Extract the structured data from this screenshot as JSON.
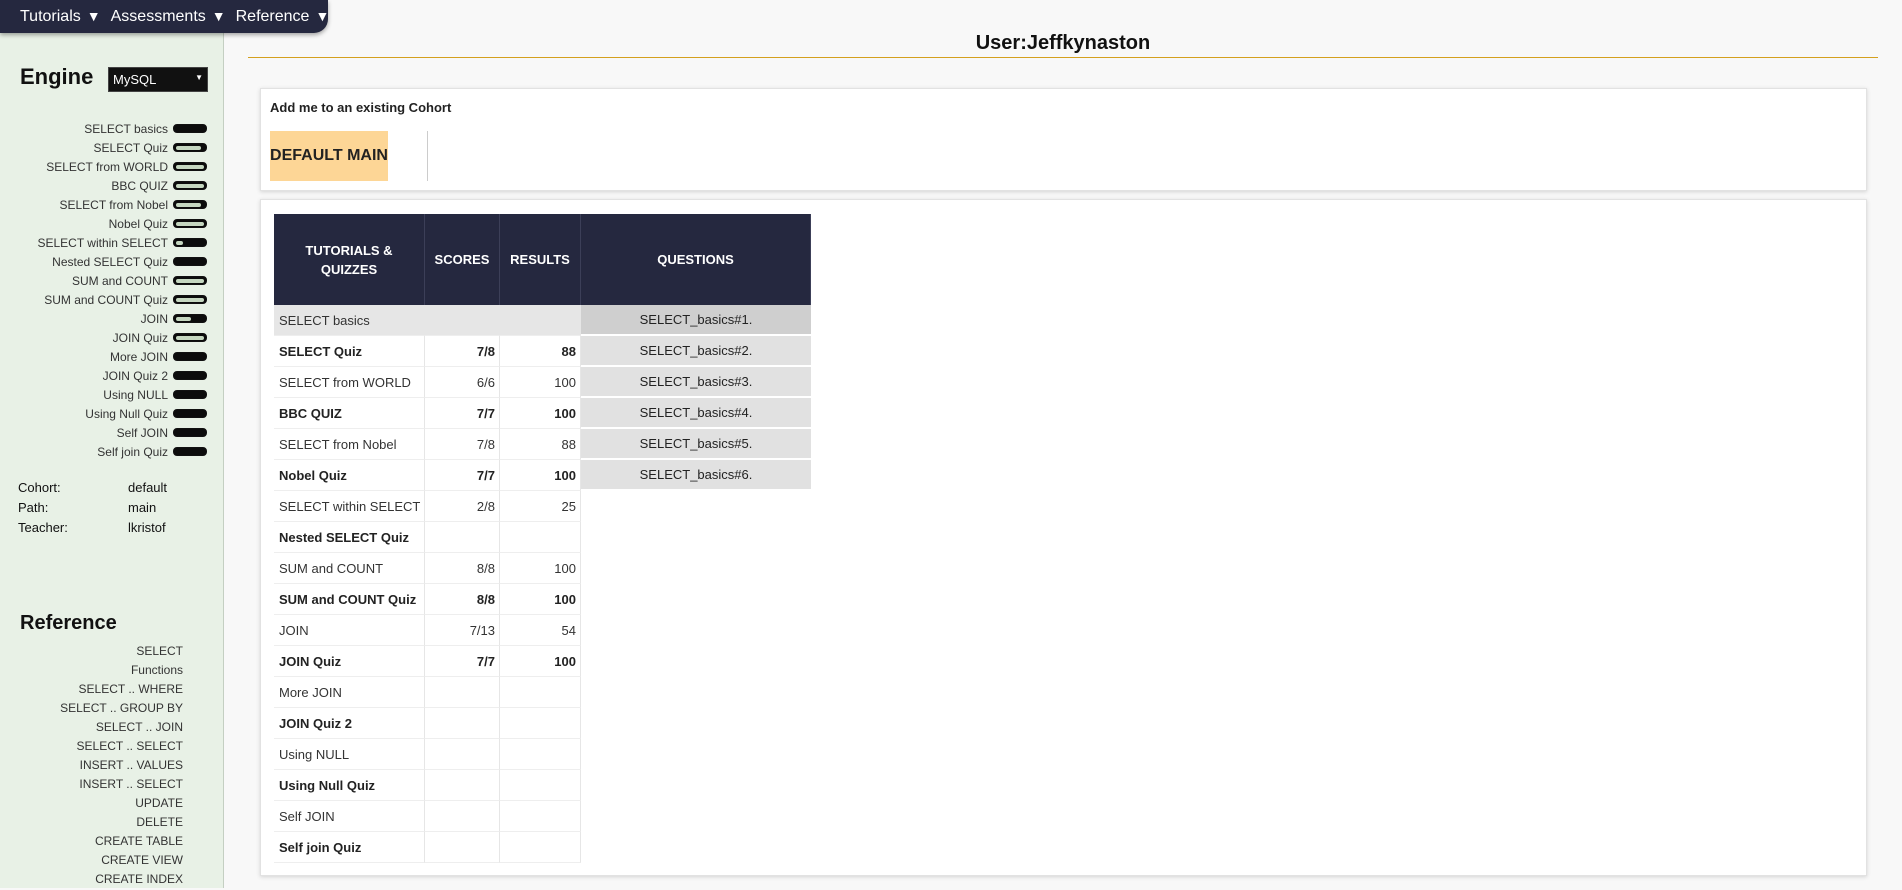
{
  "nav": {
    "items": [
      {
        "label": "Tutorials",
        "arrow": "▼"
      },
      {
        "label": "Assessments",
        "arrow": "▼"
      },
      {
        "label": "Reference",
        "arrow": "▼"
      }
    ]
  },
  "sidebar": {
    "engine_label": "Engine",
    "engine_value": "MySQL",
    "tutorials": [
      {
        "label": "SELECT basics",
        "progress": 0
      },
      {
        "label": "SELECT Quiz",
        "progress": 0.88
      },
      {
        "label": "SELECT from WORLD",
        "progress": 1.0
      },
      {
        "label": "BBC QUIZ",
        "progress": 1.0
      },
      {
        "label": "SELECT from Nobel",
        "progress": 0.88
      },
      {
        "label": "Nobel Quiz",
        "progress": 1.0
      },
      {
        "label": "SELECT within SELECT",
        "progress": 0.25
      },
      {
        "label": "Nested SELECT Quiz",
        "progress": 0
      },
      {
        "label": "SUM and COUNT",
        "progress": 1.0
      },
      {
        "label": "SUM and COUNT Quiz",
        "progress": 1.0
      },
      {
        "label": "JOIN",
        "progress": 0.54
      },
      {
        "label": "JOIN Quiz",
        "progress": 1.0
      },
      {
        "label": "More JOIN",
        "progress": 0
      },
      {
        "label": "JOIN Quiz 2",
        "progress": 0
      },
      {
        "label": "Using NULL",
        "progress": 0
      },
      {
        "label": "Using Null Quiz",
        "progress": 0
      },
      {
        "label": "Self JOIN",
        "progress": 0
      },
      {
        "label": "Self join Quiz",
        "progress": 0
      }
    ],
    "info": [
      {
        "key": "Cohort:",
        "value": "default"
      },
      {
        "key": "Path:",
        "value": "main"
      },
      {
        "key": "Teacher:",
        "value": "lkristof"
      }
    ],
    "reference_heading": "Reference",
    "reference_items": [
      "SELECT",
      "Functions",
      "SELECT .. WHERE",
      "SELECT .. GROUP BY",
      "SELECT .. JOIN",
      "SELECT .. SELECT",
      "INSERT .. VALUES",
      "INSERT .. SELECT",
      "UPDATE",
      "DELETE",
      "CREATE TABLE",
      "CREATE VIEW",
      "CREATE INDEX"
    ]
  },
  "main": {
    "title": "User:Jeffkynaston",
    "cohort_panel": {
      "title": "Add me to an existing Cohort",
      "button": "DEFAULT MAIN"
    },
    "table": {
      "headers": {
        "tutorials_line1": "TUTORIALS &",
        "tutorials_line2": "QUIZZES",
        "scores": "SCORES",
        "results": "RESULTS",
        "questions": "QUESTIONS"
      },
      "rows": [
        {
          "name": "SELECT basics",
          "score": "",
          "result": "",
          "bold": false
        },
        {
          "name": "SELECT Quiz",
          "score": "7/8",
          "result": "88",
          "bold": true
        },
        {
          "name": "SELECT from WORLD",
          "score": "6/6",
          "result": "100",
          "bold": false
        },
        {
          "name": "BBC QUIZ",
          "score": "7/7",
          "result": "100",
          "bold": true
        },
        {
          "name": "SELECT from Nobel",
          "score": "7/8",
          "result": "88",
          "bold": false
        },
        {
          "name": "Nobel Quiz",
          "score": "7/7",
          "result": "100",
          "bold": true
        },
        {
          "name": "SELECT within SELECT",
          "score": "2/8",
          "result": "25",
          "bold": false
        },
        {
          "name": "Nested SELECT Quiz",
          "score": "",
          "result": "",
          "bold": true
        },
        {
          "name": "SUM and COUNT",
          "score": "8/8",
          "result": "100",
          "bold": false
        },
        {
          "name": "SUM and COUNT Quiz",
          "score": "8/8",
          "result": "100",
          "bold": true
        },
        {
          "name": "JOIN",
          "score": "7/13",
          "result": "54",
          "bold": false
        },
        {
          "name": "JOIN Quiz",
          "score": "7/7",
          "result": "100",
          "bold": true
        },
        {
          "name": "More JOIN",
          "score": "",
          "result": "",
          "bold": false
        },
        {
          "name": "JOIN Quiz 2",
          "score": "",
          "result": "",
          "bold": true
        },
        {
          "name": "Using NULL",
          "score": "",
          "result": "",
          "bold": false
        },
        {
          "name": "Using Null Quiz",
          "score": "",
          "result": "",
          "bold": true
        },
        {
          "name": "Self JOIN",
          "score": "",
          "result": "",
          "bold": false
        },
        {
          "name": "Self join Quiz",
          "score": "",
          "result": "",
          "bold": true
        }
      ],
      "selected_row": 0,
      "questions": [
        "SELECT_basics#1.",
        "SELECT_basics#2.",
        "SELECT_basics#3.",
        "SELECT_basics#4.",
        "SELECT_basics#5.",
        "SELECT_basics#6."
      ]
    }
  },
  "colors": {
    "nav_bg": "#25283f",
    "sidebar_bg": "#e8f1e6",
    "accent_rule": "#d4a01e",
    "button_bg": "#fdd696"
  }
}
